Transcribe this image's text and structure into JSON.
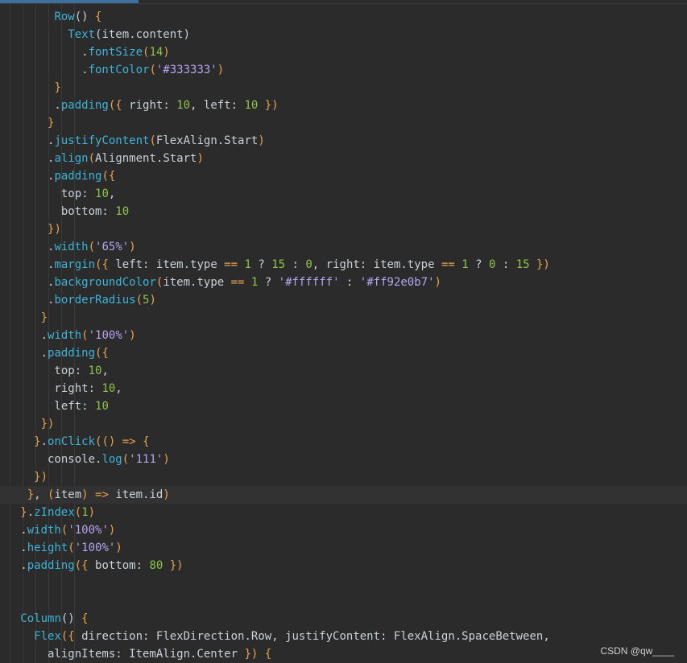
{
  "watermark": "CSDN @qw____",
  "code_lines": [
    {
      "indent": 0,
      "current": false,
      "tokens": [
        [
          "        ",
          "plain"
        ],
        [
          "Row",
          "fn"
        ],
        [
          "() ",
          "plain"
        ],
        [
          "{",
          "brace"
        ]
      ]
    },
    {
      "indent": 0,
      "current": false,
      "tokens": [
        [
          "          ",
          "plain"
        ],
        [
          "Text",
          "fn"
        ],
        [
          "(item.content)",
          "plain"
        ]
      ]
    },
    {
      "indent": 0,
      "current": false,
      "tokens": [
        [
          "            .",
          "plain"
        ],
        [
          "fontSize",
          "fn"
        ],
        [
          "(",
          "brace"
        ],
        [
          "14",
          "num"
        ],
        [
          ")",
          "brace"
        ]
      ]
    },
    {
      "indent": 0,
      "current": false,
      "tokens": [
        [
          "            .",
          "plain"
        ],
        [
          "fontColor",
          "fn"
        ],
        [
          "(",
          "brace"
        ],
        [
          "'#333333'",
          "str"
        ],
        [
          ")",
          "brace"
        ]
      ]
    },
    {
      "indent": 0,
      "current": false,
      "tokens": [
        [
          "        ",
          "plain"
        ],
        [
          "}",
          "brace"
        ]
      ]
    },
    {
      "indent": 0,
      "current": false,
      "tokens": [
        [
          "        .",
          "plain"
        ],
        [
          "padding",
          "fn"
        ],
        [
          "({ ",
          "brace"
        ],
        [
          "right: ",
          "plain"
        ],
        [
          "10",
          "num"
        ],
        [
          ", left: ",
          "plain"
        ],
        [
          "10",
          "num"
        ],
        [
          " })",
          "brace"
        ]
      ]
    },
    {
      "indent": 0,
      "current": false,
      "tokens": [
        [
          "       ",
          "plain"
        ],
        [
          "}",
          "brace"
        ]
      ]
    },
    {
      "indent": 0,
      "current": false,
      "tokens": [
        [
          "       .",
          "plain"
        ],
        [
          "justifyContent",
          "fn"
        ],
        [
          "(",
          "brace"
        ],
        [
          "FlexAlign.Start",
          "plain"
        ],
        [
          ")",
          "brace"
        ]
      ]
    },
    {
      "indent": 0,
      "current": false,
      "tokens": [
        [
          "       .",
          "plain"
        ],
        [
          "align",
          "fn"
        ],
        [
          "(",
          "brace"
        ],
        [
          "Alignment.Start",
          "plain"
        ],
        [
          ")",
          "brace"
        ]
      ]
    },
    {
      "indent": 0,
      "current": false,
      "tokens": [
        [
          "       .",
          "plain"
        ],
        [
          "padding",
          "fn"
        ],
        [
          "({",
          "brace"
        ]
      ]
    },
    {
      "indent": 0,
      "current": false,
      "tokens": [
        [
          "         top: ",
          "plain"
        ],
        [
          "10",
          "num"
        ],
        [
          ",",
          "plain"
        ]
      ]
    },
    {
      "indent": 0,
      "current": false,
      "tokens": [
        [
          "         bottom: ",
          "plain"
        ],
        [
          "10",
          "num"
        ]
      ]
    },
    {
      "indent": 0,
      "current": false,
      "tokens": [
        [
          "       ",
          "plain"
        ],
        [
          "})",
          "brace"
        ]
      ]
    },
    {
      "indent": 0,
      "current": false,
      "tokens": [
        [
          "       .",
          "plain"
        ],
        [
          "width",
          "fn"
        ],
        [
          "(",
          "brace"
        ],
        [
          "'65%'",
          "str"
        ],
        [
          ")",
          "brace"
        ]
      ]
    },
    {
      "indent": 0,
      "current": false,
      "tokens": [
        [
          "       .",
          "plain"
        ],
        [
          "margin",
          "fn"
        ],
        [
          "({ ",
          "brace"
        ],
        [
          "left: item.type ",
          "plain"
        ],
        [
          "==",
          "op"
        ],
        [
          " ",
          "plain"
        ],
        [
          "1",
          "num"
        ],
        [
          " ? ",
          "plain"
        ],
        [
          "15",
          "num"
        ],
        [
          " : ",
          "plain"
        ],
        [
          "0",
          "num"
        ],
        [
          ", right: item.type ",
          "plain"
        ],
        [
          "==",
          "op"
        ],
        [
          " ",
          "plain"
        ],
        [
          "1",
          "num"
        ],
        [
          " ? ",
          "plain"
        ],
        [
          "0",
          "num"
        ],
        [
          " : ",
          "plain"
        ],
        [
          "15",
          "num"
        ],
        [
          " })",
          "brace"
        ]
      ]
    },
    {
      "indent": 0,
      "current": false,
      "tokens": [
        [
          "       .",
          "plain"
        ],
        [
          "backgroundColor",
          "fn"
        ],
        [
          "(",
          "brace"
        ],
        [
          "item.type ",
          "plain"
        ],
        [
          "==",
          "op"
        ],
        [
          " ",
          "plain"
        ],
        [
          "1",
          "num"
        ],
        [
          " ? ",
          "plain"
        ],
        [
          "'#ffffff'",
          "str"
        ],
        [
          " : ",
          "plain"
        ],
        [
          "'#ff92e0b7'",
          "str"
        ],
        [
          ")",
          "brace"
        ]
      ]
    },
    {
      "indent": 0,
      "current": false,
      "tokens": [
        [
          "       .",
          "plain"
        ],
        [
          "borderRadius",
          "fn"
        ],
        [
          "(",
          "brace"
        ],
        [
          "5",
          "num"
        ],
        [
          ")",
          "brace"
        ]
      ]
    },
    {
      "indent": 0,
      "current": false,
      "tokens": [
        [
          "      ",
          "plain"
        ],
        [
          "}",
          "brace"
        ]
      ]
    },
    {
      "indent": 0,
      "current": false,
      "tokens": [
        [
          "      .",
          "plain"
        ],
        [
          "width",
          "fn"
        ],
        [
          "(",
          "brace"
        ],
        [
          "'100%'",
          "str"
        ],
        [
          ")",
          "brace"
        ]
      ]
    },
    {
      "indent": 0,
      "current": false,
      "tokens": [
        [
          "      .",
          "plain"
        ],
        [
          "padding",
          "fn"
        ],
        [
          "({",
          "brace"
        ]
      ]
    },
    {
      "indent": 0,
      "current": false,
      "tokens": [
        [
          "        top: ",
          "plain"
        ],
        [
          "10",
          "num"
        ],
        [
          ",",
          "plain"
        ]
      ]
    },
    {
      "indent": 0,
      "current": false,
      "tokens": [
        [
          "        right: ",
          "plain"
        ],
        [
          "10",
          "num"
        ],
        [
          ",",
          "plain"
        ]
      ]
    },
    {
      "indent": 0,
      "current": false,
      "tokens": [
        [
          "        left: ",
          "plain"
        ],
        [
          "10",
          "num"
        ]
      ]
    },
    {
      "indent": 0,
      "current": false,
      "tokens": [
        [
          "      ",
          "plain"
        ],
        [
          "})",
          "brace"
        ]
      ]
    },
    {
      "indent": 0,
      "current": false,
      "tokens": [
        [
          "     ",
          "plain"
        ],
        [
          "}",
          "brace"
        ],
        [
          ".",
          "plain"
        ],
        [
          "onClick",
          "fn"
        ],
        [
          "(() ",
          "brace"
        ],
        [
          "=>",
          "op"
        ],
        [
          " ",
          "plain"
        ],
        [
          "{",
          "brace"
        ]
      ]
    },
    {
      "indent": 0,
      "current": false,
      "tokens": [
        [
          "       console.",
          "plain"
        ],
        [
          "log",
          "fn"
        ],
        [
          "(",
          "brace"
        ],
        [
          "'111'",
          "str"
        ],
        [
          ")",
          "brace"
        ]
      ]
    },
    {
      "indent": 0,
      "current": false,
      "tokens": [
        [
          "     ",
          "plain"
        ],
        [
          "})",
          "brace"
        ]
      ]
    },
    {
      "indent": 0,
      "current": true,
      "tokens": [
        [
          "    ",
          "plain"
        ],
        [
          "}",
          "brace"
        ],
        [
          ", ",
          "plain"
        ],
        [
          "(",
          "brace"
        ],
        [
          "item",
          "plain"
        ],
        [
          ")",
          "brace"
        ],
        [
          " ",
          "plain"
        ],
        [
          "=>",
          "op"
        ],
        [
          " item.id",
          "plain"
        ],
        [
          ")",
          "brace"
        ]
      ]
    },
    {
      "indent": 0,
      "current": false,
      "tokens": [
        [
          "   ",
          "plain"
        ],
        [
          "}",
          "brace"
        ],
        [
          ".",
          "plain"
        ],
        [
          "zIndex",
          "fn"
        ],
        [
          "(",
          "brace"
        ],
        [
          "1",
          "num"
        ],
        [
          ")",
          "brace"
        ]
      ]
    },
    {
      "indent": 0,
      "current": false,
      "tokens": [
        [
          "   .",
          "plain"
        ],
        [
          "width",
          "fn"
        ],
        [
          "(",
          "brace"
        ],
        [
          "'100%'",
          "str"
        ],
        [
          ")",
          "brace"
        ]
      ]
    },
    {
      "indent": 0,
      "current": false,
      "tokens": [
        [
          "   .",
          "plain"
        ],
        [
          "height",
          "fn"
        ],
        [
          "(",
          "brace"
        ],
        [
          "'100%'",
          "str"
        ],
        [
          ")",
          "brace"
        ]
      ]
    },
    {
      "indent": 0,
      "current": false,
      "tokens": [
        [
          "   .",
          "plain"
        ],
        [
          "padding",
          "fn"
        ],
        [
          "({ ",
          "brace"
        ],
        [
          "bottom: ",
          "plain"
        ],
        [
          "80",
          "num"
        ],
        [
          " })",
          "brace"
        ]
      ]
    },
    {
      "indent": 0,
      "current": false,
      "tokens": [
        [
          "",
          "plain"
        ]
      ]
    },
    {
      "indent": 0,
      "current": false,
      "tokens": [
        [
          "",
          "plain"
        ]
      ]
    },
    {
      "indent": 0,
      "current": false,
      "tokens": [
        [
          "   ",
          "plain"
        ],
        [
          "Column",
          "fn"
        ],
        [
          "() ",
          "plain"
        ],
        [
          "{",
          "brace"
        ]
      ]
    },
    {
      "indent": 0,
      "current": false,
      "tokens": [
        [
          "     ",
          "plain"
        ],
        [
          "Flex",
          "fn"
        ],
        [
          "({ ",
          "brace"
        ],
        [
          "direction: FlexDirection.Row, justifyContent: FlexAlign.SpaceBetween,",
          "plain"
        ]
      ]
    },
    {
      "indent": 0,
      "current": false,
      "tokens": [
        [
          "       alignItems: ItemAlign.Center ",
          "plain"
        ],
        [
          "})",
          "brace"
        ],
        [
          " ",
          "plain"
        ],
        [
          "{",
          "brace"
        ]
      ]
    }
  ]
}
